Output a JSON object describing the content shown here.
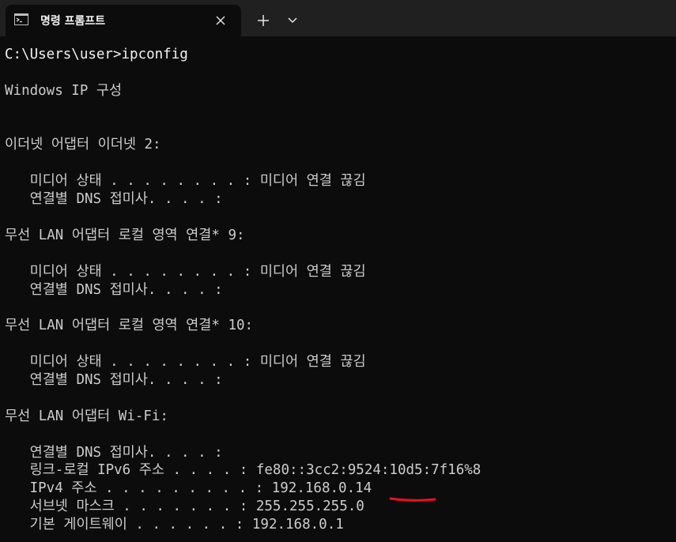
{
  "tab": {
    "title": "명령 프롬프트",
    "icon": "command-prompt-icon"
  },
  "colors": {
    "background": "#0c0c0c",
    "titlebar": "#202020",
    "text": "#cccccc",
    "annotation": "#e81123"
  },
  "terminal": {
    "lines": [
      "C:\\Users\\user>ipconfig",
      "",
      "Windows IP 구성",
      "",
      "",
      "이더넷 어댑터 이더넷 2:",
      "",
      "   미디어 상태 . . . . . . . . : 미디어 연결 끊김",
      "   연결별 DNS 접미사. . . . :",
      "",
      "무선 LAN 어댑터 로컬 영역 연결* 9:",
      "",
      "   미디어 상태 . . . . . . . . : 미디어 연결 끊김",
      "   연결별 DNS 접미사. . . . :",
      "",
      "무선 LAN 어댑터 로컬 영역 연결* 10:",
      "",
      "   미디어 상태 . . . . . . . . : 미디어 연결 끊김",
      "   연결별 DNS 접미사. . . . :",
      "",
      "무선 LAN 어댑터 Wi-Fi:",
      "",
      "   연결별 DNS 접미사. . . . :",
      "   링크-로컬 IPv6 주소 . . . . : fe80::3cc2:9524:10d5:7f16%8",
      "   IPv4 주소 . . . . . . . . . : 192.168.0.14",
      "   서브넷 마스크 . . . . . . . : 255.255.255.0",
      "   기본 게이트웨이 . . . . . . : 192.168.0.1"
    ]
  }
}
